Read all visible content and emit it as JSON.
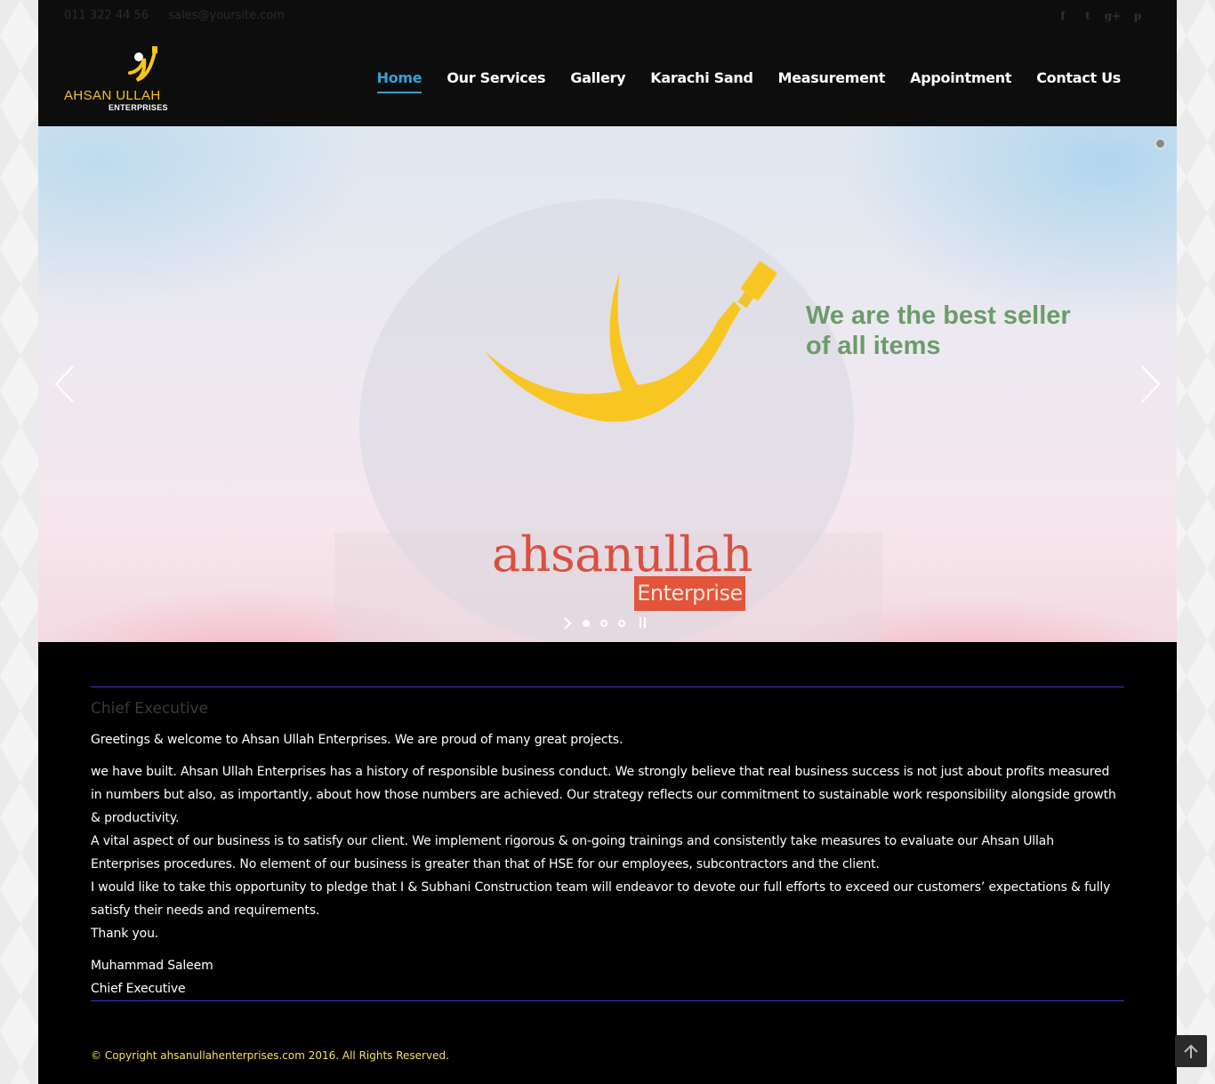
{
  "topbar": {
    "phone": "011 322 44 56",
    "email": "sales@yoursite.com",
    "social": [
      {
        "name": "facebook-icon",
        "glyph": "f"
      },
      {
        "name": "twitter-icon",
        "glyph": "t"
      },
      {
        "name": "google-plus-icon",
        "glyph": "g+"
      },
      {
        "name": "pinterest-icon",
        "glyph": "p"
      }
    ]
  },
  "logo": {
    "line1": "AHSAN ULLAH",
    "line2": "ENTERPRISES"
  },
  "nav": [
    {
      "label": "Home",
      "active": true
    },
    {
      "label": "Our Services"
    },
    {
      "label": "Gallery"
    },
    {
      "label": "Karachi Sand"
    },
    {
      "label": "Measurement"
    },
    {
      "label": "Appointment"
    },
    {
      "label": "Contact Us"
    }
  ],
  "slider": {
    "slogan": "We are the best seller of all items",
    "brand_main": "ahsanullah",
    "brand_sub": "Enterprise",
    "slide_count": 3,
    "active_slide": 1
  },
  "message": {
    "heading": "Chief Executive",
    "paragraphs": [
      "Greetings & welcome to Ahsan Ullah Enterprises. We are proud of many great projects.",
      "we have built. Ahsan Ullah Enterprises has a history of responsible business conduct. We strongly believe that real business success is not just about profits measured in numbers but also, as importantly, about how those numbers are achieved. Our strategy reflects our commitment to sustainable work responsibility alongside growth & productivity.",
      "A vital aspect of our business is to satisfy our client. We implement rigorous & on-going trainings and consistently take measures to evaluate our Ahsan Ullah Enterprises procedures. No element of our business is greater than that of HSE for our employees, subcontractors and the client.",
      "I would like to take this opportunity to pledge that I & Subhani Construction team will endeavor to devote our full efforts to exceed our customers’ expectations & fully satisfy their needs and requirements.",
      "Thank you."
    ],
    "signature_name": "Muhammad Saleem",
    "signature_title": "Chief Executive"
  },
  "footer": {
    "copyright": "© Copyright ahsanullahenterprises.com 2016. All Rights Reserved."
  },
  "colors": {
    "accent": "#35a0d6",
    "brand_yellow": "#f5c415",
    "brand_red": "#e2553b",
    "divider": "#4b2bd6",
    "slogan_green": "#6b9c6b"
  }
}
